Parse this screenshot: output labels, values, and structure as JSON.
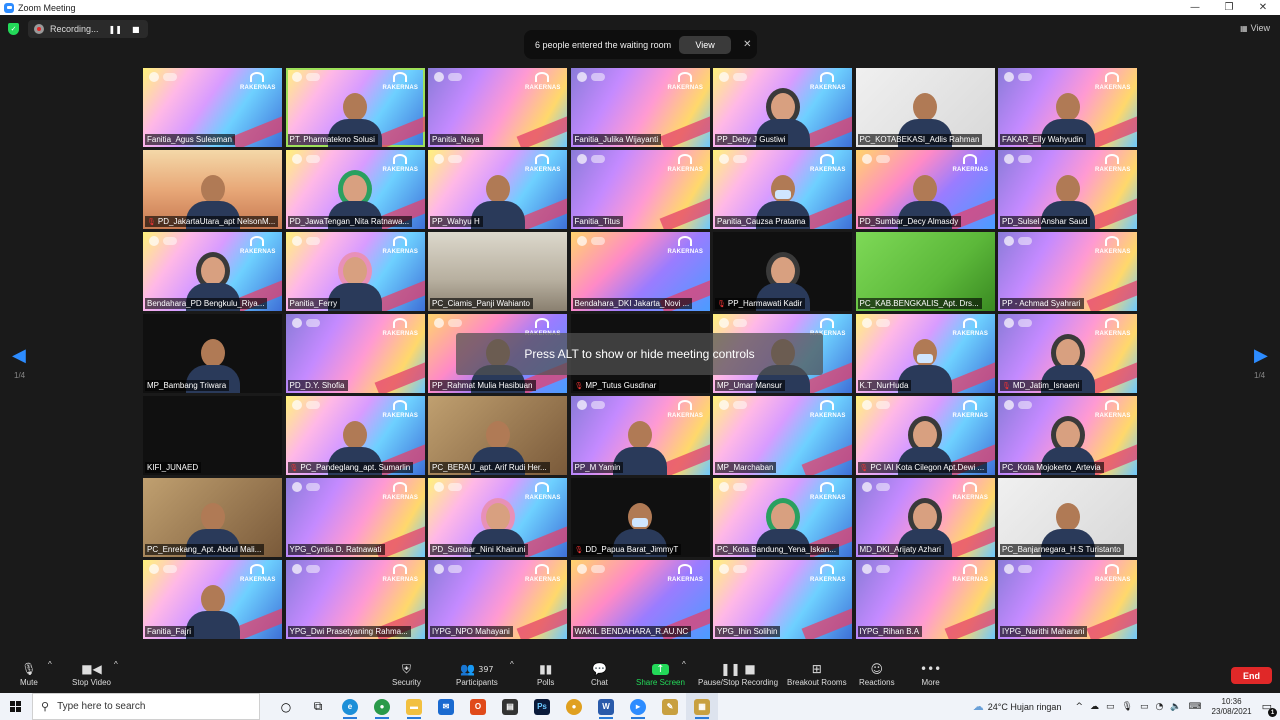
{
  "window": {
    "title": "Zoom Meeting",
    "controls": [
      "—",
      "❐",
      "✕"
    ]
  },
  "topbar": {
    "recording_label": "Recording...",
    "pause_icon": "❚❚",
    "stop_icon": "■",
    "view_label": "View"
  },
  "waiting_room": {
    "message": "6 people entered the waiting room",
    "view_button": "View",
    "close": "✕"
  },
  "brand": {
    "logo_text": "RAKERNAS",
    "accent": "#2d8cff",
    "active_speaker": "#9ee05a",
    "end": "#e02828"
  },
  "participants": [
    {
      "name": "Fanitia_Agus Suleaman",
      "muted": false
    },
    {
      "name": "PT. Pharmatekno Solusi",
      "muted": false
    },
    {
      "name": "Panitia_Naya",
      "muted": false
    },
    {
      "name": "Fanitia_Julika Wijayanti",
      "muted": false
    },
    {
      "name": "PP_Deby J Gustiwi",
      "muted": false
    },
    {
      "name": "PC_KOTABEKASI_Adlis Rahman",
      "muted": false
    },
    {
      "name": "FAKAR_Elly Wahyudin",
      "muted": false
    },
    {
      "name": "PD_JakartaUtara_apt NelsonM...",
      "muted": true
    },
    {
      "name": "PD_JawaTengan_Nita Ratnawa...",
      "muted": false
    },
    {
      "name": "PP_Wahyu H",
      "muted": false
    },
    {
      "name": "Fanitia_Titus",
      "muted": false
    },
    {
      "name": "Panitia_Cauzsa Pratama",
      "muted": false
    },
    {
      "name": "PD_Sumbar_Decy Almasdy",
      "muted": false
    },
    {
      "name": "PD_Sulsel Anshar Saud",
      "muted": false
    },
    {
      "name": "Bendahara_PD Bengkulu_Riya...",
      "muted": false
    },
    {
      "name": "Panitia_Ferry",
      "muted": false
    },
    {
      "name": "PC_Ciamis_Panji Wahianto",
      "muted": false
    },
    {
      "name": "Bendahara_DKI Jakarta_Novi ...",
      "muted": false
    },
    {
      "name": "PP_Harmawati Kadir",
      "muted": true
    },
    {
      "name": "PC_KAB.BENGKALIS_Apt. Drs...",
      "muted": false
    },
    {
      "name": "PP - Achmad Syahrari",
      "muted": false
    },
    {
      "name": "MP_Bambang Triwara",
      "muted": false
    },
    {
      "name": "PD_D.Y. Shofia",
      "muted": false
    },
    {
      "name": "PP_Rahmat Mulia Hasibuan",
      "muted": false
    },
    {
      "name": "MP_Tutus Gusdinar",
      "muted": true
    },
    {
      "name": "MP_Umar Mansur",
      "muted": false
    },
    {
      "name": "K.T_NurHuda",
      "muted": false
    },
    {
      "name": "MD_Jatim_Isnaeni",
      "muted": true
    },
    {
      "name": "KIFI_JUNAED",
      "muted": false
    },
    {
      "name": "PC_Pandeglang_apt. Sumarlin",
      "muted": true
    },
    {
      "name": "PC_BERAU_apt. Arif Rudi Her...",
      "muted": false
    },
    {
      "name": "PP_M Yamin",
      "muted": false
    },
    {
      "name": "MP_Marchaban",
      "muted": false
    },
    {
      "name": "PC IAI Kota Cilegon Apt.Dewi ...",
      "muted": true
    },
    {
      "name": "PC_Kota Mojokerto_Artevia",
      "muted": false
    },
    {
      "name": "PC_Enrekang_Apt. Abdul Mali...",
      "muted": false
    },
    {
      "name": "YPG_Cyntia D. Ratnawati",
      "muted": false
    },
    {
      "name": "PD_Sumbar_Nini Khairuni",
      "muted": false
    },
    {
      "name": "DD_Papua Barat_JimmyT",
      "muted": true
    },
    {
      "name": "PC_Kota Bandung_Yena_Iskan...",
      "muted": false
    },
    {
      "name": "MD_DKI_Arijaty Azhari",
      "muted": false
    },
    {
      "name": "PC_Banjarnegara_H.S Turistanto",
      "muted": false
    },
    {
      "name": "Fanitia_Fajri",
      "muted": false
    },
    {
      "name": "YPG_Dwi Prasetyaning Rahma...",
      "muted": false
    },
    {
      "name": "IYPG_NPO Mahayani",
      "muted": false
    },
    {
      "name": "WAKIL BENDAHARA_R.AU.NC",
      "muted": false
    },
    {
      "name": "YPG_Ihin Solihin",
      "muted": false
    },
    {
      "name": "IYPG_Rihan B.A",
      "muted": false
    },
    {
      "name": "IYPG_Narithi Maharani",
      "muted": false
    }
  ],
  "overlay": {
    "hint": "Press ALT to show or hide meeting controls"
  },
  "pagination": {
    "left_label": "1/4",
    "right_label": "1/4"
  },
  "toolbar": {
    "mute": "Mute",
    "stop_video": "Stop Video",
    "security": "Security",
    "participants": "Participants",
    "participant_count": "397",
    "polls": "Polls",
    "chat": "Chat",
    "share_screen": "Share Screen",
    "pause_recording": "Pause/Stop Recording",
    "breakout_rooms": "Breakout Rooms",
    "reactions": "Reactions",
    "more": "More",
    "end": "End"
  },
  "taskbar": {
    "search_placeholder": "Type here to search",
    "weather": "24°C  Hujan ringan",
    "time": "10:36",
    "date": "23/08/2021",
    "notifications": "1"
  }
}
